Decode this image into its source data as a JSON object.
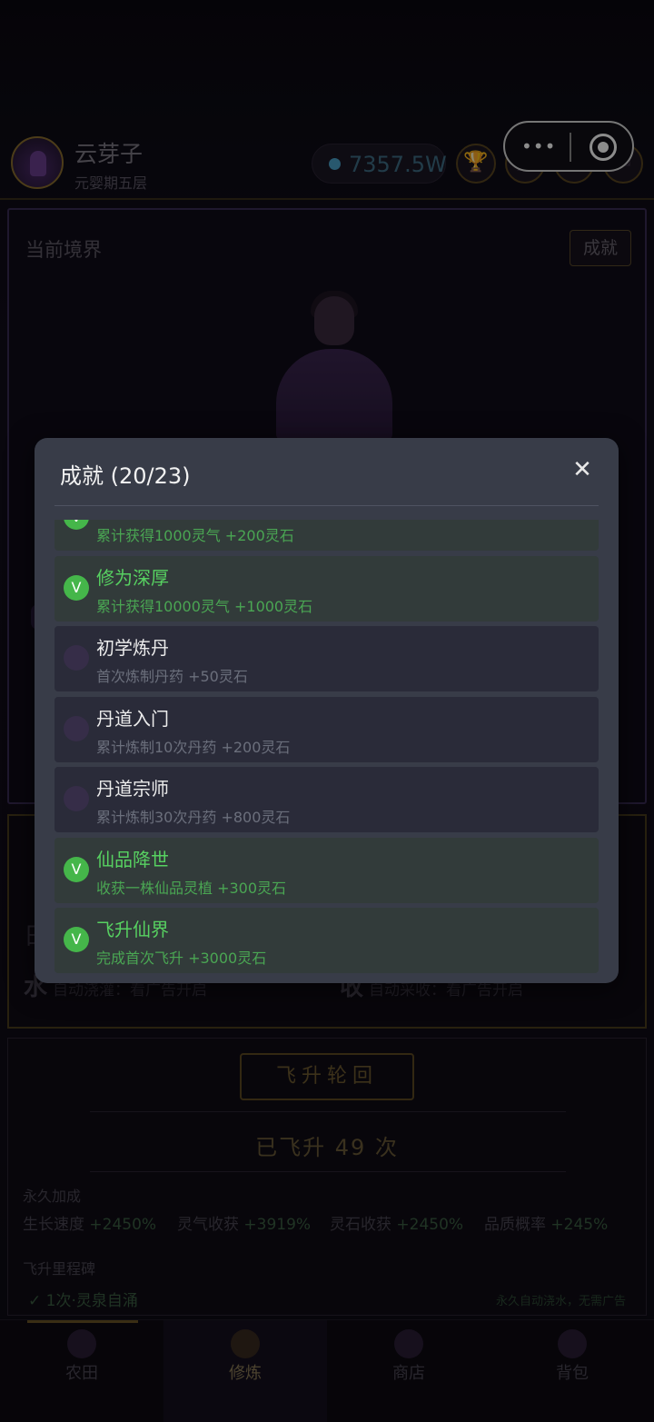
{
  "header": {
    "user_name": "云芽子",
    "user_realm": "元婴期五层",
    "spirit_stones": "7357.5W",
    "icons": [
      "trophy-icon",
      "book-icon",
      "help-icon",
      "mail-icon"
    ]
  },
  "mini_capsule": {
    "more_icon": "•••",
    "close_icon": "target-icon"
  },
  "realm_panel": {
    "title": "当前境界",
    "achievements_button": "成就"
  },
  "farm_panel": {
    "partial_label": "日",
    "auto_water_icon": "水",
    "auto_water_label": "自动浇灌：看广告开启",
    "auto_harvest_icon": "收",
    "auto_harvest_label": "自动采收：看广告开启"
  },
  "ascend_panel": {
    "button": "飞升轮回",
    "count_text": "已飞升 49 次",
    "permanent_title": "永久加成",
    "bonuses": [
      {
        "label": "生长速度",
        "value": "+2450%"
      },
      {
        "label": "灵气收获",
        "value": "+3919%"
      },
      {
        "label": "灵石收获",
        "value": "+2450%"
      },
      {
        "label": "品质概率",
        "value": "+245%"
      }
    ],
    "milestone_title": "飞升里程碑",
    "milestone_item": "✓ 1次·灵泉自涌",
    "milestone_note": "永久自动浇水，无需广告"
  },
  "tabbar": {
    "tabs": [
      {
        "label": "农田",
        "icon": "farm-icon"
      },
      {
        "label": "修炼",
        "icon": "cultivate-icon"
      },
      {
        "label": "商店",
        "icon": "shop-icon"
      },
      {
        "label": "背包",
        "icon": "bag-icon"
      }
    ],
    "active": "修炼"
  },
  "modal": {
    "title": "成就 (20/23)",
    "close_icon": "close-icon",
    "check_glyph": "V",
    "items": [
      {
        "name": "",
        "desc": "累计获得1000灵气 +200灵石",
        "done": true
      },
      {
        "name": "修为深厚",
        "desc": "累计获得10000灵气 +1000灵石",
        "done": true
      },
      {
        "name": "初学炼丹",
        "desc": "首次炼制丹药 +50灵石",
        "done": false
      },
      {
        "name": "丹道入门",
        "desc": "累计炼制10次丹药 +200灵石",
        "done": false
      },
      {
        "name": "丹道宗师",
        "desc": "累计炼制30次丹药 +800灵石",
        "done": false
      },
      {
        "name": "仙品降世",
        "desc": "收获一株仙品灵植 +300灵石",
        "done": true
      },
      {
        "name": "飞升仙界",
        "desc": "完成首次飞升 +3000灵石",
        "done": true
      }
    ]
  },
  "colors": {
    "modal_bg": "#383c48",
    "done_green": "#57d161",
    "check_green": "#45b64a",
    "gold_border": "#5a4620"
  }
}
